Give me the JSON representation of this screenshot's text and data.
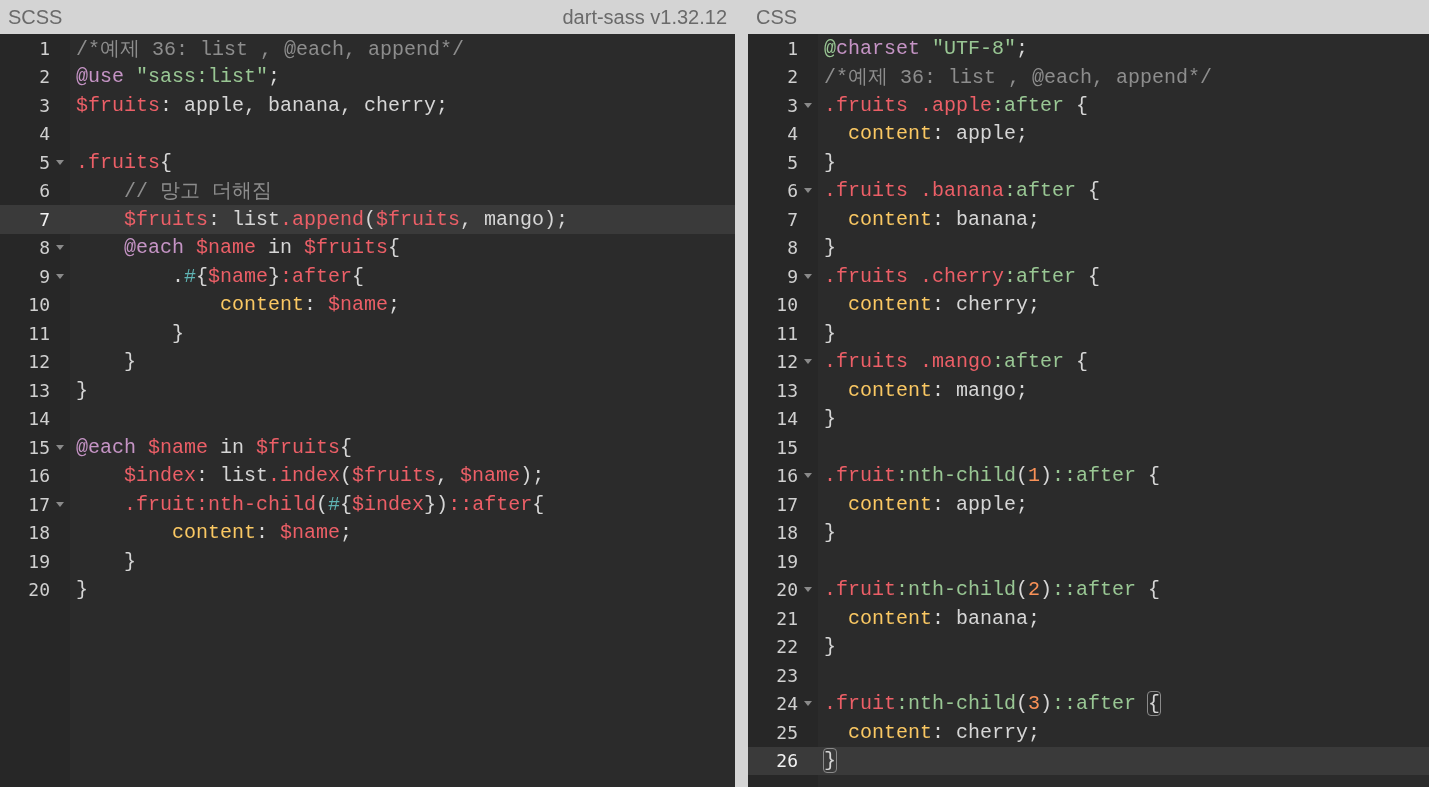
{
  "panes": [
    {
      "title": "SCSS",
      "version": "dart-sass v1.32.12",
      "lines": [
        {
          "number": "1",
          "foldable": false,
          "current": false,
          "tokens": [
            {
              "kind": "comment",
              "text": "/*예제 36: list , @each, append*/"
            }
          ]
        },
        {
          "number": "2",
          "foldable": false,
          "current": false,
          "tokens": [
            {
              "kind": "keyword",
              "text": "@use "
            },
            {
              "kind": "string",
              "text": "\"sass:list\""
            },
            {
              "kind": "plain",
              "text": ";"
            }
          ]
        },
        {
          "number": "3",
          "foldable": false,
          "current": false,
          "tokens": [
            {
              "kind": "variable",
              "text": "$fruits"
            },
            {
              "kind": "plain",
              "text": ": apple, banana, cherry;"
            }
          ]
        },
        {
          "number": "4",
          "foldable": false,
          "current": false
        },
        {
          "number": "5",
          "foldable": true,
          "current": false,
          "tokens": [
            {
              "kind": "variable",
              "text": ".fruits"
            },
            {
              "kind": "plain",
              "text": "{"
            }
          ]
        },
        {
          "number": "6",
          "foldable": false,
          "current": false,
          "tokens": [
            {
              "kind": "comment",
              "text": "    // 망고 더해짐"
            }
          ]
        },
        {
          "number": "7",
          "foldable": false,
          "current": true,
          "tokens": [
            {
              "kind": "variable",
              "text": "    $fruits"
            },
            {
              "kind": "plain",
              "text": ": list"
            },
            {
              "kind": "variable",
              "text": ".append"
            },
            {
              "kind": "plain",
              "text": "("
            },
            {
              "kind": "variable",
              "text": "$fruits"
            },
            {
              "kind": "plain",
              "text": ", mango);"
            }
          ]
        },
        {
          "number": "8",
          "foldable": true,
          "current": false,
          "tokens": [
            {
              "kind": "keyword",
              "text": "    @each "
            },
            {
              "kind": "variable",
              "text": "$name"
            },
            {
              "kind": "plain",
              "text": " in "
            },
            {
              "kind": "variable",
              "text": "$fruits"
            },
            {
              "kind": "plain",
              "text": "{"
            }
          ]
        },
        {
          "number": "9",
          "foldable": true,
          "current": false,
          "tokens": [
            {
              "kind": "plain",
              "text": "        ."
            },
            {
              "kind": "operator",
              "text": "#"
            },
            {
              "kind": "plain",
              "text": "{"
            },
            {
              "kind": "variable",
              "text": "$name"
            },
            {
              "kind": "plain",
              "text": "}"
            },
            {
              "kind": "variable",
              "text": ":after"
            },
            {
              "kind": "plain",
              "text": "{"
            }
          ]
        },
        {
          "number": "10",
          "foldable": false,
          "current": false,
          "tokens": [
            {
              "kind": "property",
              "text": "            content"
            },
            {
              "kind": "plain",
              "text": ": "
            },
            {
              "kind": "variable",
              "text": "$name"
            },
            {
              "kind": "plain",
              "text": ";"
            }
          ]
        },
        {
          "number": "11",
          "foldable": false,
          "current": false,
          "tokens": [
            {
              "kind": "plain",
              "text": "        }"
            }
          ]
        },
        {
          "number": "12",
          "foldable": false,
          "current": false,
          "tokens": [
            {
              "kind": "plain",
              "text": "    }"
            }
          ]
        },
        {
          "number": "13",
          "foldable": false,
          "current": false,
          "tokens": [
            {
              "kind": "plain",
              "text": "}"
            }
          ]
        },
        {
          "number": "14",
          "foldable": false,
          "current": false
        },
        {
          "number": "15",
          "foldable": true,
          "current": false,
          "tokens": [
            {
              "kind": "keyword",
              "text": "@each "
            },
            {
              "kind": "variable",
              "text": "$name"
            },
            {
              "kind": "plain",
              "text": " in "
            },
            {
              "kind": "variable",
              "text": "$fruits"
            },
            {
              "kind": "plain",
              "text": "{"
            }
          ]
        },
        {
          "number": "16",
          "foldable": false,
          "current": false,
          "tokens": [
            {
              "kind": "variable",
              "text": "    $index"
            },
            {
              "kind": "plain",
              "text": ": list"
            },
            {
              "kind": "variable",
              "text": ".index"
            },
            {
              "kind": "plain",
              "text": "("
            },
            {
              "kind": "variable",
              "text": "$fruits"
            },
            {
              "kind": "plain",
              "text": ", "
            },
            {
              "kind": "variable",
              "text": "$name"
            },
            {
              "kind": "plain",
              "text": ");"
            }
          ]
        },
        {
          "number": "17",
          "foldable": true,
          "current": false,
          "tokens": [
            {
              "kind": "variable",
              "text": "    .fruit:nth-child"
            },
            {
              "kind": "plain",
              "text": "("
            },
            {
              "kind": "operator",
              "text": "#"
            },
            {
              "kind": "plain",
              "text": "{"
            },
            {
              "kind": "variable",
              "text": "$index"
            },
            {
              "kind": "plain",
              "text": "})"
            },
            {
              "kind": "variable",
              "text": "::after"
            },
            {
              "kind": "plain",
              "text": "{"
            }
          ]
        },
        {
          "number": "18",
          "foldable": false,
          "current": false,
          "tokens": [
            {
              "kind": "property",
              "text": "        content"
            },
            {
              "kind": "plain",
              "text": ": "
            },
            {
              "kind": "variable",
              "text": "$name"
            },
            {
              "kind": "plain",
              "text": ";"
            }
          ]
        },
        {
          "number": "19",
          "foldable": false,
          "current": false,
          "tokens": [
            {
              "kind": "plain",
              "text": "    }"
            }
          ]
        },
        {
          "number": "20",
          "foldable": false,
          "current": false,
          "tokens": [
            {
              "kind": "plain",
              "text": "}"
            }
          ]
        }
      ]
    },
    {
      "title": "CSS",
      "lines": [
        {
          "number": "1",
          "foldable": false,
          "current": false,
          "tokens": [
            {
              "kind": "pseudo",
              "text": "@"
            },
            {
              "kind": "keyword",
              "text": "charset "
            },
            {
              "kind": "string",
              "text": "\"UTF-8\""
            },
            {
              "kind": "plain",
              "text": ";"
            }
          ]
        },
        {
          "number": "2",
          "foldable": false,
          "current": false,
          "tokens": [
            {
              "kind": "comment",
              "text": "/*예제 36: list , @each, append*/"
            }
          ]
        },
        {
          "number": "3",
          "foldable": true,
          "current": false,
          "tokens": [
            {
              "kind": "variable",
              "text": ".fruits .apple"
            },
            {
              "kind": "pseudo",
              "text": ":after"
            },
            {
              "kind": "plain",
              "text": " {"
            }
          ]
        },
        {
          "number": "4",
          "foldable": false,
          "current": false,
          "tokens": [
            {
              "kind": "property",
              "text": "  content"
            },
            {
              "kind": "plain",
              "text": ": apple;"
            }
          ]
        },
        {
          "number": "5",
          "foldable": false,
          "current": false,
          "tokens": [
            {
              "kind": "plain",
              "text": "}"
            }
          ]
        },
        {
          "number": "6",
          "foldable": true,
          "current": false,
          "tokens": [
            {
              "kind": "variable",
              "text": ".fruits .banana"
            },
            {
              "kind": "pseudo",
              "text": ":after"
            },
            {
              "kind": "plain",
              "text": " {"
            }
          ]
        },
        {
          "number": "7",
          "foldable": false,
          "current": false,
          "tokens": [
            {
              "kind": "property",
              "text": "  content"
            },
            {
              "kind": "plain",
              "text": ": banana;"
            }
          ]
        },
        {
          "number": "8",
          "foldable": false,
          "current": false,
          "tokens": [
            {
              "kind": "plain",
              "text": "}"
            }
          ]
        },
        {
          "number": "9",
          "foldable": true,
          "current": false,
          "tokens": [
            {
              "kind": "variable",
              "text": ".fruits .cherry"
            },
            {
              "kind": "pseudo",
              "text": ":after"
            },
            {
              "kind": "plain",
              "text": " {"
            }
          ]
        },
        {
          "number": "10",
          "foldable": false,
          "current": false,
          "tokens": [
            {
              "kind": "property",
              "text": "  content"
            },
            {
              "kind": "plain",
              "text": ": cherry;"
            }
          ]
        },
        {
          "number": "11",
          "foldable": false,
          "current": false,
          "tokens": [
            {
              "kind": "plain",
              "text": "}"
            }
          ]
        },
        {
          "number": "12",
          "foldable": true,
          "current": false,
          "tokens": [
            {
              "kind": "variable",
              "text": ".fruits .mango"
            },
            {
              "kind": "pseudo",
              "text": ":after"
            },
            {
              "kind": "plain",
              "text": " {"
            }
          ]
        },
        {
          "number": "13",
          "foldable": false,
          "current": false,
          "tokens": [
            {
              "kind": "property",
              "text": "  content"
            },
            {
              "kind": "plain",
              "text": ": mango;"
            }
          ]
        },
        {
          "number": "14",
          "foldable": false,
          "current": false,
          "tokens": [
            {
              "kind": "plain",
              "text": "}"
            }
          ]
        },
        {
          "number": "15",
          "foldable": false,
          "current": false
        },
        {
          "number": "16",
          "foldable": true,
          "current": false,
          "tokens": [
            {
              "kind": "variable",
              "text": ".fruit"
            },
            {
              "kind": "pseudo",
              "text": ":nth-child"
            },
            {
              "kind": "plain",
              "text": "("
            },
            {
              "kind": "number",
              "text": "1"
            },
            {
              "kind": "plain",
              "text": ")"
            },
            {
              "kind": "pseudo",
              "text": "::after"
            },
            {
              "kind": "plain",
              "text": " {"
            }
          ]
        },
        {
          "number": "17",
          "foldable": false,
          "current": false,
          "tokens": [
            {
              "kind": "property",
              "text": "  content"
            },
            {
              "kind": "plain",
              "text": ": apple;"
            }
          ]
        },
        {
          "number": "18",
          "foldable": false,
          "current": false,
          "tokens": [
            {
              "kind": "plain",
              "text": "}"
            }
          ]
        },
        {
          "number": "19",
          "foldable": false,
          "current": false
        },
        {
          "number": "20",
          "foldable": true,
          "current": false,
          "tokens": [
            {
              "kind": "variable",
              "text": ".fruit"
            },
            {
              "kind": "pseudo",
              "text": ":nth-child"
            },
            {
              "kind": "plain",
              "text": "("
            },
            {
              "kind": "number",
              "text": "2"
            },
            {
              "kind": "plain",
              "text": ")"
            },
            {
              "kind": "pseudo",
              "text": "::after"
            },
            {
              "kind": "plain",
              "text": " {"
            }
          ]
        },
        {
          "number": "21",
          "foldable": false,
          "current": false,
          "tokens": [
            {
              "kind": "property",
              "text": "  content"
            },
            {
              "kind": "plain",
              "text": ": banana;"
            }
          ]
        },
        {
          "number": "22",
          "foldable": false,
          "current": false,
          "tokens": [
            {
              "kind": "plain",
              "text": "}"
            }
          ]
        },
        {
          "number": "23",
          "foldable": false,
          "current": false
        },
        {
          "number": "24",
          "foldable": true,
          "current": false,
          "tokens": [
            {
              "kind": "variable",
              "text": ".fruit"
            },
            {
              "kind": "pseudo",
              "text": ":nth-child"
            },
            {
              "kind": "plain",
              "text": "("
            },
            {
              "kind": "number",
              "text": "3"
            },
            {
              "kind": "plain",
              "text": ")"
            },
            {
              "kind": "pseudo",
              "text": "::after "
            },
            {
              "kind": "bracket",
              "text": "{"
            }
          ]
        },
        {
          "number": "25",
          "foldable": false,
          "current": false,
          "tokens": [
            {
              "kind": "property",
              "text": "  content"
            },
            {
              "kind": "plain",
              "text": ": cherry;"
            }
          ]
        },
        {
          "number": "26",
          "foldable": false,
          "current": true,
          "tokens": [
            {
              "kind": "bracket",
              "text": "}"
            }
          ]
        }
      ]
    }
  ]
}
